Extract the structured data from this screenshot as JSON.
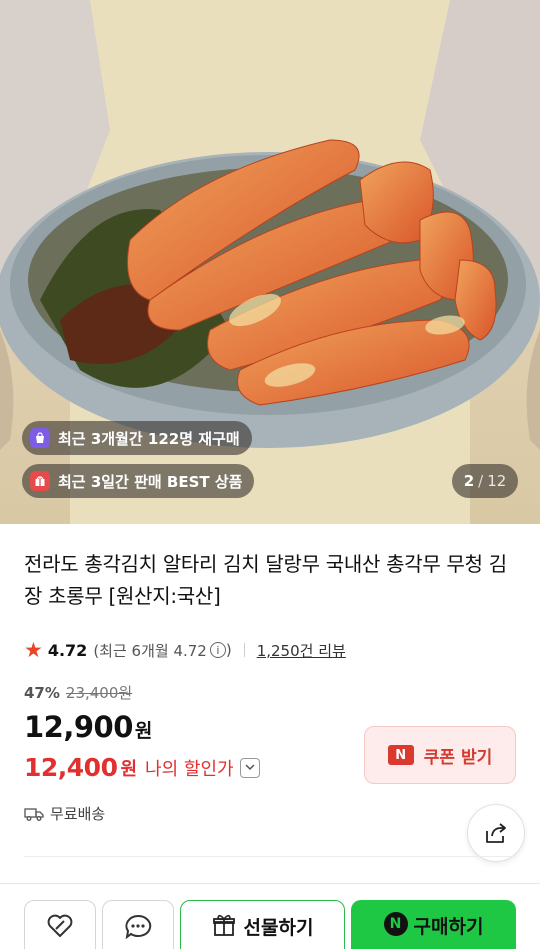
{
  "hero": {
    "badges": [
      {
        "icon": "purple-bag-icon",
        "text": "최근 3개월간 122명 재구매"
      },
      {
        "icon": "gift-box-icon",
        "text": "최근 3일간 판매 BEST 상품"
      }
    ],
    "counter": {
      "current": "2",
      "separator": "/",
      "total": "12"
    }
  },
  "product": {
    "title": "전라도 총각김치 알타리 김치 달랑무 국내산 총각무 무청 김장 초롱무 [원산지:국산]",
    "rating": {
      "score": "4.72",
      "recent": "(최근 6개월 4.72",
      "recent_close": ")",
      "reviews": "1,250건 리뷰"
    },
    "discount_pct": "47%",
    "original_price": "23,400원",
    "price": "12,900",
    "price_unit": "원",
    "my_price": "12,400",
    "my_price_unit": "원",
    "my_price_label": "나의 할인가",
    "coupon": {
      "logo": "N",
      "label": "쿠폰 받기"
    },
    "shipping": "무료배송"
  },
  "bottom_bar": {
    "gift_label": "선물하기",
    "buy_logo": "N",
    "buy_label": "구매하기"
  },
  "colors": {
    "accent_red": "#e03030",
    "buy_green": "#1ec845",
    "gift_border": "#2db84a",
    "star": "#e8462b"
  }
}
